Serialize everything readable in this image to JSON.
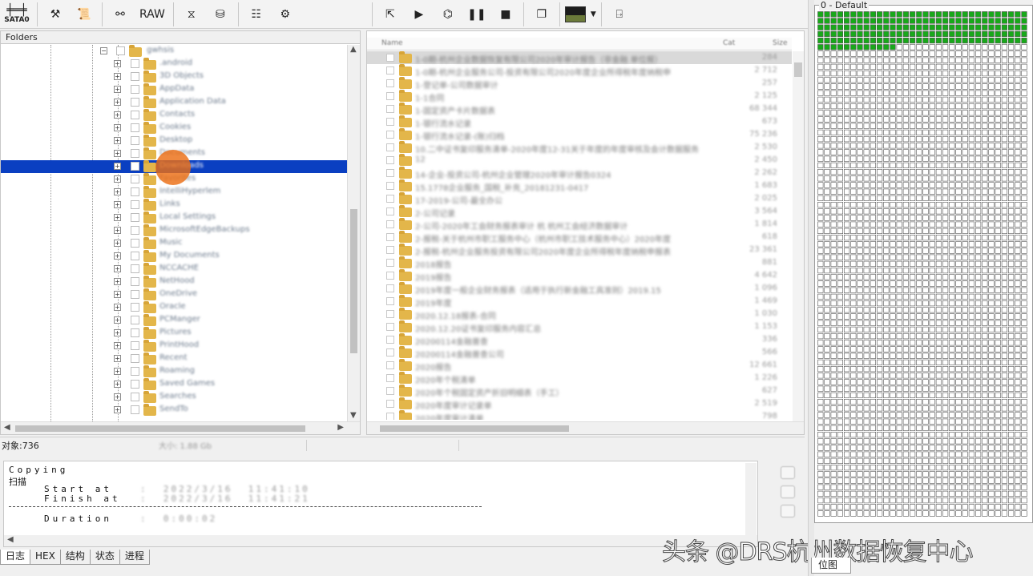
{
  "toolbar": {
    "sata_label": "SATA0",
    "raw_label": "RAW"
  },
  "folders": {
    "header": "Folders",
    "root_label": "gwhsis",
    "items": [
      ".android",
      "3D Objects",
      "AppData",
      "Application Data",
      "Contacts",
      "Cookies",
      "Desktop",
      "Documents",
      "Downloads",
      "Favorites",
      "IntelliHyperlem",
      "Links",
      "Local Settings",
      "MicrosoftEdgeBackups",
      "Music",
      "My Documents",
      "NCCACHE",
      "NetHood",
      "OneDrive",
      "Oracle",
      "PCManger",
      "Pictures",
      "PrintHood",
      "Recent",
      "Roaming",
      "Saved Games",
      "Searches",
      "SendTo"
    ],
    "selected_index": 8
  },
  "files": {
    "col_name": "Name",
    "col_cat": "Cat",
    "col_size": "Size",
    "rows": [
      {
        "name": "1-0期-杭州企业数据恢复有限公司2020年审计报告（非金融 单位报）",
        "size": "284"
      },
      {
        "name": "1-0期-杭州企业服务公司-投资有限公司2020年度企业所得税年度纳税申",
        "size": "2 712"
      },
      {
        "name": "1-登记单-公司数据审计",
        "size": "257"
      },
      {
        "name": "1-1合同",
        "size": "2 125"
      },
      {
        "name": "1-固定资产卡片数据表",
        "size": "68 344"
      },
      {
        "name": "1-银行流水记录",
        "size": "673"
      },
      {
        "name": "1-银行流水记录-(账)归档",
        "size": "75 236"
      },
      {
        "name": "10.二中证书复印服务清单-2020年度12-31关于年度的年度审核及会计数据服务",
        "size": "2 530"
      },
      {
        "name": "12",
        "size": "2 450"
      },
      {
        "name": "14-企业-投资公司-杭州企业管理2020年审计报告0324",
        "size": "2 262"
      },
      {
        "name": "15.1778企业服务_国税_补充_20181231-0417",
        "size": "1 683"
      },
      {
        "name": "17-2019-公司-最全办公",
        "size": "2 025"
      },
      {
        "name": "2-公司记录",
        "size": "3 564"
      },
      {
        "name": "2-公司-2020年工会财务报表审计 杭 杭州工会经济数据审计",
        "size": "1 814"
      },
      {
        "name": "2-报税-关于杭州市职工服务中心（杭州市职工技术服务中心）2020年度",
        "size": "618"
      },
      {
        "name": "2-报税-杭州企业服务投资有限公司2020年度企业所得税年度纳税申报表",
        "size": "23 361"
      },
      {
        "name": "2018报告",
        "size": "881"
      },
      {
        "name": "2019报告",
        "size": "4 642"
      },
      {
        "name": "2019年度一般企业财务报表（适用于执行新金融工具准则）2019.15",
        "size": "1 096"
      },
      {
        "name": "2019年度",
        "size": "1 469"
      },
      {
        "name": "2020.12.18报表-合同",
        "size": "1 030"
      },
      {
        "name": "2020.12.20证书复印服务内容汇总",
        "size": "1 153"
      },
      {
        "name": "20200114金融普查",
        "size": "336"
      },
      {
        "name": "20200114金融普查公司",
        "size": "566"
      },
      {
        "name": "2020报告",
        "size": "12 661"
      },
      {
        "name": "2020年个税清单",
        "size": "1 226"
      },
      {
        "name": "2020年个税固定资产折旧明细表（手工）",
        "size": "627"
      },
      {
        "name": "2020年度审计记录单",
        "size": "2 519"
      },
      {
        "name": "2020年度审计清单",
        "size": "798"
      }
    ]
  },
  "status": {
    "objects": "对象:736",
    "size": "大小: 1.88 Gb"
  },
  "log": {
    "line1": "Copying",
    "line2": "扫描",
    "start_label": "Start at",
    "start_value": ":  2022/3/16  11:41:10",
    "finish_label": "Finish at",
    "finish_value": ":  2022/3/16  11:41:21",
    "duration_label": "Duration",
    "duration_value": ":  0:00:02"
  },
  "tabs": [
    "日志",
    "HEX",
    "结构",
    "状态",
    "进程"
  ],
  "map": {
    "title": "0 - Default",
    "tab": "位图",
    "used_fraction": 0.07,
    "used_color": "#18a81a"
  },
  "watermark": "头条 @DRS杭州数据恢复中心"
}
